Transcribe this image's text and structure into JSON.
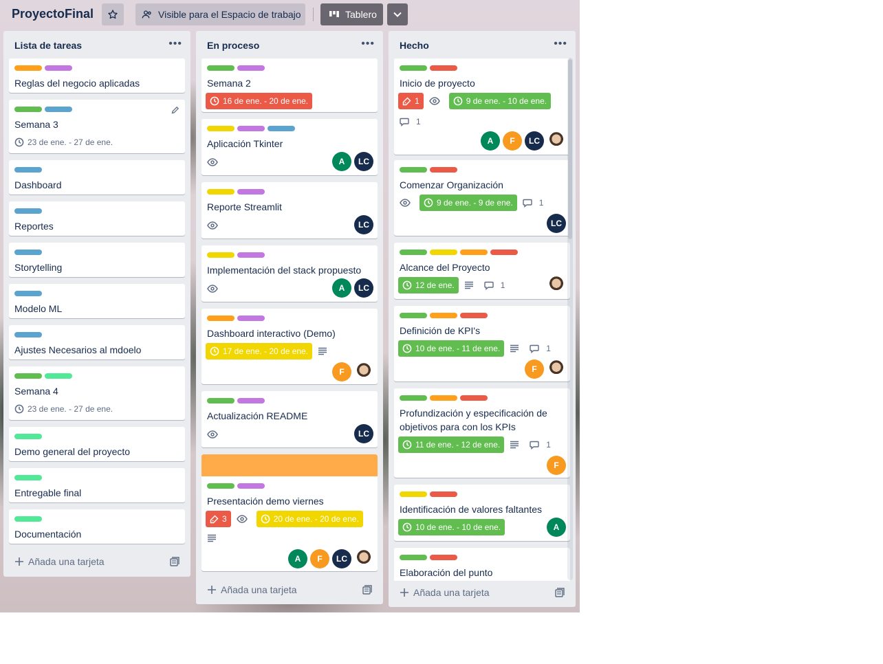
{
  "board": {
    "title": "ProyectoFinal",
    "visibility_label": "Visible para el Espacio de trabajo",
    "view_label": "Tablero"
  },
  "colors": {
    "green": "#61bd4f",
    "yellow": "#f2d600",
    "orange": "#ff9f1a",
    "red": "#eb5a46",
    "purple": "#c377e0",
    "blue": "#5ba4cf",
    "lime": "#51e898"
  },
  "add_card_label": "Añada una tarjeta",
  "lists": [
    {
      "title": "Lista de tareas",
      "cards": [
        {
          "title": "Reglas del negocio aplicadas",
          "labels": [
            "orange",
            "purple"
          ]
        },
        {
          "title": "Semana 3",
          "labels": [
            "green",
            "blue"
          ],
          "date": "23 de ene. - 27 de ene."
        },
        {
          "title": "Dashboard",
          "labels": [
            "blue"
          ]
        },
        {
          "title": "Reportes",
          "labels": [
            "blue"
          ]
        },
        {
          "title": "Storytelling",
          "labels": [
            "blue"
          ]
        },
        {
          "title": "Modelo ML",
          "labels": [
            "blue"
          ]
        },
        {
          "title": "Ajustes Necesarios al mdoelo",
          "labels": [
            "blue"
          ]
        },
        {
          "title": "Semana 4",
          "labels": [
            "green",
            "lime"
          ],
          "date": "23 de ene. - 27 de ene."
        },
        {
          "title": "Demo general del proyecto",
          "labels": [
            "lime"
          ]
        },
        {
          "title": "Entregable final",
          "labels": [
            "lime"
          ]
        },
        {
          "title": "Documentación",
          "labels": [
            "lime"
          ]
        }
      ]
    },
    {
      "title": "En proceso",
      "cards": [
        {
          "title": "Semana 2",
          "labels": [
            "green",
            "purple"
          ],
          "date": "16 de ene. - 20 de ene."
        },
        {
          "title": "Aplicación Tkinter",
          "labels": [
            "yellow",
            "purple",
            "blue"
          ],
          "members": [
            "A",
            "LC"
          ]
        },
        {
          "title": "Reporte Streamlit",
          "labels": [
            "yellow",
            "purple"
          ],
          "members": [
            "LC"
          ]
        },
        {
          "title": "Implementación del stack propuesto",
          "labels": [
            "yellow",
            "purple"
          ],
          "members": [
            "A",
            "LC"
          ]
        },
        {
          "title": "Dashboard interactivo (Demo)",
          "labels": [
            "orange",
            "purple"
          ],
          "date": "17 de ene. - 20 de ene.",
          "members": [
            "F"
          ]
        },
        {
          "title": "Actualización README",
          "labels": [
            "green",
            "purple"
          ],
          "members": [
            "LC"
          ]
        },
        {
          "title": "Presentación demo viernes",
          "labels": [
            "green",
            "purple"
          ],
          "attachments": "3",
          "date": "20 de ene. - 20 de ene.",
          "members": [
            "A",
            "F",
            "LC"
          ]
        }
      ]
    },
    {
      "title": "Hecho",
      "cards": [
        {
          "title": "Inicio de proyecto",
          "labels": [
            "green",
            "red"
          ],
          "attachments": "1",
          "date": "9 de ene. - 10 de ene.",
          "comments": "1",
          "members": [
            "A",
            "F",
            "LC"
          ]
        },
        {
          "title": "Comenzar Organización",
          "labels": [
            "green",
            "red"
          ],
          "date": "9 de ene. - 9 de ene.",
          "comments": "1",
          "members": [
            "LC"
          ]
        },
        {
          "title": "Alcance del Proyecto",
          "labels": [
            "green",
            "yellow",
            "orange",
            "red"
          ],
          "date": "12 de ene.",
          "comments": "1"
        },
        {
          "title": "Definición de KPI's",
          "labels": [
            "green",
            "orange",
            "red"
          ],
          "date": "10 de ene. - 11 de ene.",
          "comments": "1",
          "members": [
            "F"
          ]
        },
        {
          "title": "Profundización y especificación de objetivos para con los KPIs",
          "labels": [
            "green",
            "orange",
            "red"
          ],
          "date": "11 de ene. - 12 de ene.",
          "comments": "1",
          "members": [
            "F"
          ]
        },
        {
          "title": "Identificación de valores faltantes",
          "labels": [
            "yellow",
            "red"
          ],
          "date": "10 de ene. - 10 de ene.",
          "members": [
            "A"
          ]
        },
        {
          "title": "Elaboración del punto",
          "labels": [
            "green",
            "red"
          ]
        }
      ]
    }
  ]
}
